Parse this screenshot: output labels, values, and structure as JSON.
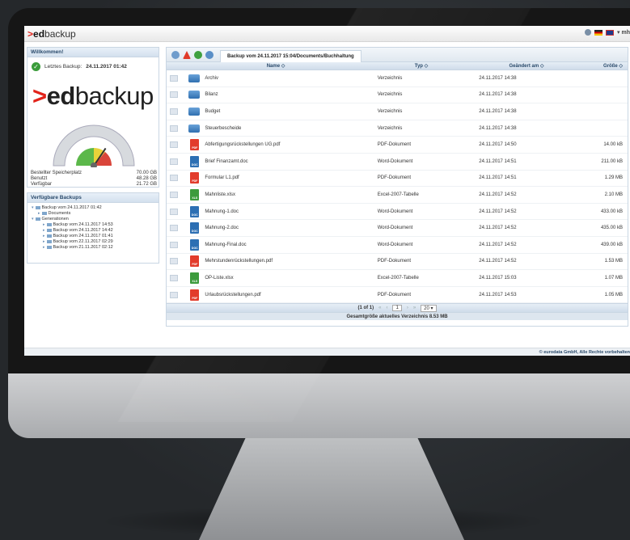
{
  "app": {
    "logo_prefix": "ed",
    "logo_suffix": "backup",
    "user": "mh",
    "copyright": "© eurodata GmbH, Alle Rechte vorbehalten"
  },
  "welcome": {
    "title": "Willkommen!",
    "last_backup_label": "Letztes Backup:",
    "last_backup_value": "24.11.2017 01:42",
    "storage": [
      {
        "label": "Bestellter Speicherplatz",
        "value": "70.00 GB"
      },
      {
        "label": "Benutzt",
        "value": "48.28 GB"
      },
      {
        "label": "Verfügbar",
        "value": "21.72 GB"
      }
    ],
    "gauge_fraction": 0.69
  },
  "backups": {
    "title": "Verfügbare Backups",
    "items": [
      {
        "label": "Backup vom 24.11.2017 01:42",
        "level": 0
      },
      {
        "label": "Documents",
        "level": 1
      },
      {
        "label": "Generationen",
        "level": 0
      },
      {
        "label": "Backup vom 24.11.2017 14:53",
        "level": 2
      },
      {
        "label": "Backup vom 24.11.2017 14:42",
        "level": 2
      },
      {
        "label": "Backup vom 24.11.2017 01:41",
        "level": 2
      },
      {
        "label": "Backup vom 22.11.2017 02:29",
        "level": 2
      },
      {
        "label": "Backup vom 21.11.2017 02:12",
        "level": 2
      }
    ]
  },
  "tab": {
    "label": "Backup vom 24.11.2017 15:04/Documents/Buchhaltung"
  },
  "table": {
    "headers": {
      "name": "Name ◇",
      "typ": "Typ ◇",
      "date": "Geändert am ◇",
      "size": "Größe ◇"
    },
    "rows": [
      {
        "icon": "folder",
        "name": "Archiv",
        "typ": "Verzeichnis",
        "date": "24.11.2017 14:38",
        "size": ""
      },
      {
        "icon": "folder",
        "name": "Bilanz",
        "typ": "Verzeichnis",
        "date": "24.11.2017 14:38",
        "size": ""
      },
      {
        "icon": "folder",
        "name": "Budget",
        "typ": "Verzeichnis",
        "date": "24.11.2017 14:38",
        "size": ""
      },
      {
        "icon": "folder",
        "name": "Steuerbescheide",
        "typ": "Verzeichnis",
        "date": "24.11.2017 14:38",
        "size": ""
      },
      {
        "icon": "pdf",
        "name": "Abfertigungsrückstellungen UG.pdf",
        "typ": "PDF-Dokument",
        "date": "24.11.2017 14:50",
        "size": "14.00 kB"
      },
      {
        "icon": "doc",
        "name": "Brief Finanzamt.doc",
        "typ": "Word-Dokument",
        "date": "24.11.2017 14:51",
        "size": "211.00 kB"
      },
      {
        "icon": "pdf",
        "name": "Formular L1.pdf",
        "typ": "PDF-Dokument",
        "date": "24.11.2017 14:51",
        "size": "1.29 MB"
      },
      {
        "icon": "xls",
        "name": "Mahnliste.xlsx",
        "typ": "Excel-2007-Tabelle",
        "date": "24.11.2017 14:52",
        "size": "2.10 MB"
      },
      {
        "icon": "doc",
        "name": "Mahnung-1.doc",
        "typ": "Word-Dokument",
        "date": "24.11.2017 14:52",
        "size": "433.00 kB"
      },
      {
        "icon": "doc",
        "name": "Mahnung-2.doc",
        "typ": "Word-Dokument",
        "date": "24.11.2017 14:52",
        "size": "435.00 kB"
      },
      {
        "icon": "doc",
        "name": "Mahnung-Final.doc",
        "typ": "Word-Dokument",
        "date": "24.11.2017 14:52",
        "size": "439.00 kB"
      },
      {
        "icon": "pdf",
        "name": "Mehrstundenrückstellungen.pdf",
        "typ": "PDF-Dokument",
        "date": "24.11.2017 14:52",
        "size": "1.53 MB"
      },
      {
        "icon": "xls",
        "name": "OP-Liste.xlsx",
        "typ": "Excel-2007-Tabelle",
        "date": "24.11.2017 15:03",
        "size": "1.07 MB"
      },
      {
        "icon": "pdf",
        "name": "Urlaubsrückstellungen.pdf",
        "typ": "PDF-Dokument",
        "date": "24.11.2017 14:53",
        "size": "1.05 MB"
      }
    ]
  },
  "pager": {
    "info": "(1 of 1)",
    "page": "1",
    "per_page": "20"
  },
  "total": "Gesamtgröße aktuelles Verzeichnis 8.53 MB",
  "colors": {
    "brand_red": "#e2231a",
    "header_blue": "#2a4a6b"
  }
}
